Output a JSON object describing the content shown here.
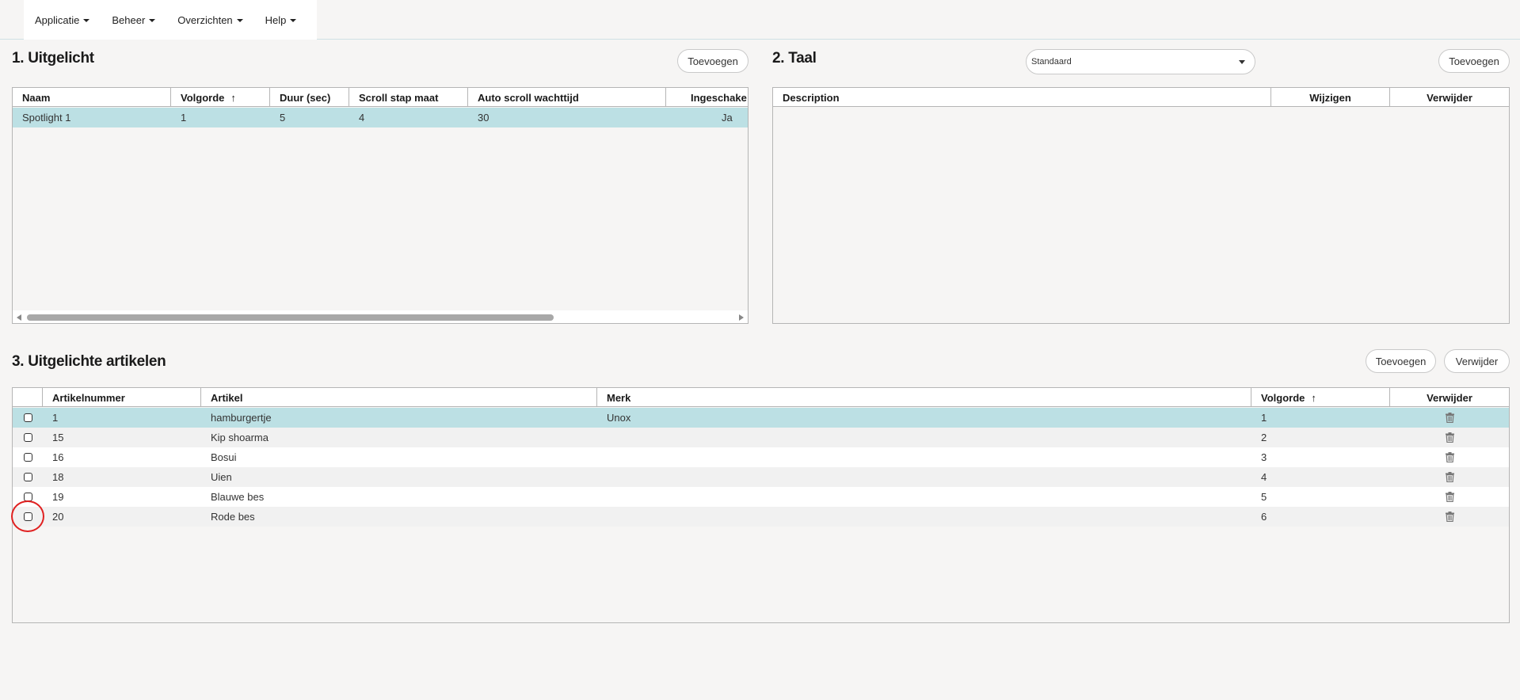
{
  "nav": {
    "items": [
      {
        "label": "Applicatie"
      },
      {
        "label": "Beheer"
      },
      {
        "label": "Overzichten"
      },
      {
        "label": "Help"
      }
    ]
  },
  "section1": {
    "title": "1. Uitgelicht",
    "add_label": "Toevoegen",
    "columns": [
      "Naam",
      "Volgorde",
      "Duur (sec)",
      "Scroll stap maat",
      "Auto scroll wachttijd",
      "Ingeschake"
    ],
    "sort_indicator": "↑",
    "rows": [
      {
        "naam": "Spotlight 1",
        "volgorde": "1",
        "duur": "5",
        "scroll": "4",
        "wachttijd": "30",
        "ingeschakeld": "Ja"
      }
    ]
  },
  "section2": {
    "title": "2. Taal",
    "language_select": "Standaard",
    "add_label": "Toevoegen",
    "columns": [
      "Description",
      "Wijzigen",
      "Verwijder"
    ]
  },
  "section3": {
    "title": "3. Uitgelichte artikelen",
    "add_label": "Toevoegen",
    "delete_label": "Verwijder",
    "columns": [
      "Artikelnummer",
      "Artikel",
      "Merk",
      "Volgorde",
      "Verwijder"
    ],
    "sort_indicator": "↑",
    "rows": [
      {
        "nummer": "1",
        "artikel": "hamburgertje",
        "merk": "Unox",
        "volgorde": "1"
      },
      {
        "nummer": "15",
        "artikel": "Kip shoarma",
        "merk": "",
        "volgorde": "2"
      },
      {
        "nummer": "16",
        "artikel": "Bosui",
        "merk": "",
        "volgorde": "3"
      },
      {
        "nummer": "18",
        "artikel": "Uien",
        "merk": "",
        "volgorde": "4"
      },
      {
        "nummer": "19",
        "artikel": "Blauwe bes",
        "merk": "",
        "volgorde": "5"
      },
      {
        "nummer": "20",
        "artikel": "Rode bes",
        "merk": "",
        "volgorde": "6"
      }
    ]
  },
  "icons": {
    "trash": "trash-icon",
    "checkbox": "checkbox-icon"
  },
  "colors": {
    "selected_row": "#bce0e4",
    "annotation": "#e02020"
  }
}
